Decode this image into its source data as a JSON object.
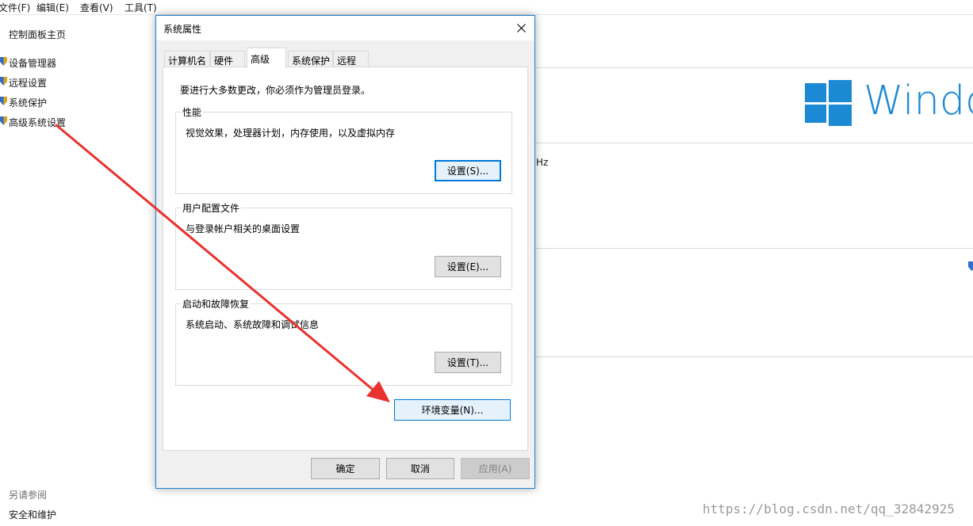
{
  "menubar": {
    "items": [
      "文件(F)",
      "编辑(E)",
      "查看(V)",
      "工具(T)"
    ]
  },
  "sidebar": {
    "home": "控制面板主页",
    "links": [
      "设备管理器",
      "远程设置",
      "系统保护",
      "高级系统设置"
    ],
    "see_also_title": "另请参阅",
    "see_also_links": [
      "安全和维护"
    ]
  },
  "background": {
    "logo_text": "Windo",
    "hz_fragment": "Hz"
  },
  "dialog": {
    "title": "系统属性",
    "tabs": [
      "计算机名",
      "硬件",
      "高级",
      "系统保护",
      "远程"
    ],
    "active_tab": "高级",
    "admin_note": "要进行大多数更改，你必须作为管理员登录。",
    "performance": {
      "title": "性能",
      "desc": "视觉效果，处理器计划，内存使用，以及虚拟内存",
      "button": "设置(S)..."
    },
    "user_profiles": {
      "title": "用户配置文件",
      "desc": "与登录帐户相关的桌面设置",
      "button": "设置(E)..."
    },
    "startup_recovery": {
      "title": "启动和故障恢复",
      "desc": "系统启动、系统故障和调试信息",
      "button": "设置(T)..."
    },
    "env_button": "环境变量(N)...",
    "ok": "确定",
    "cancel": "取消",
    "apply": "应用(A)"
  },
  "watermark": "https://blog.csdn.net/qq_32842925",
  "colors": {
    "accent": "#0078d7",
    "windows_blue": "#1b89d4",
    "arrow_red": "#e8322f"
  }
}
